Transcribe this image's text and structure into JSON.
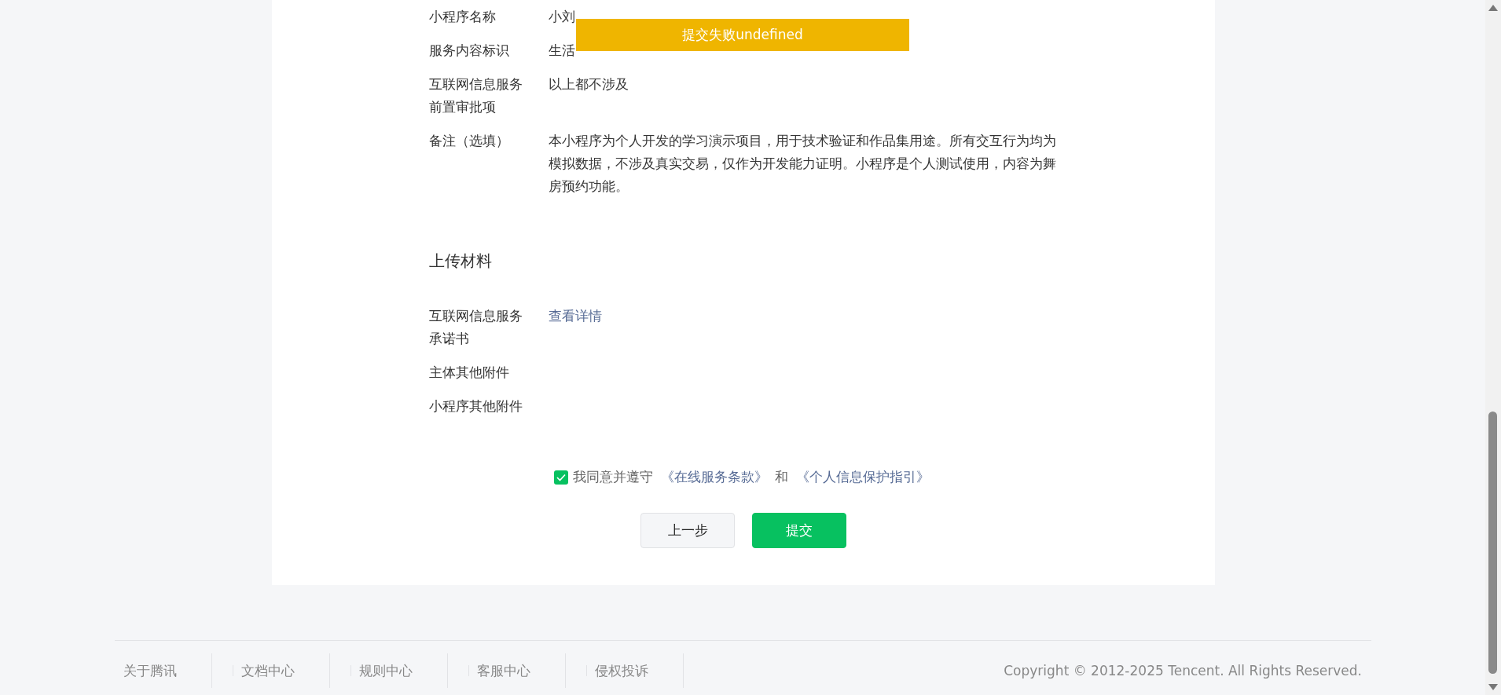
{
  "info_rows": [
    {
      "label": "小程序名称",
      "value": "小刘"
    },
    {
      "label": "服务内容标识",
      "value": "生活"
    },
    {
      "label": "互联网信息服务前置审批项",
      "value": "以上都不涉及"
    },
    {
      "label": "备注（选填）",
      "value": "本小程序为个人开发的学习演示项目，用于技术验证和作品集用途。所有交互行为均为模拟数据，不涉及真实交易，仅作为开发能力证明。小程序是个人测试使用，内容为舞房预约功能。"
    }
  ],
  "toast": {
    "text": "提交失败undefined"
  },
  "upload_section": {
    "title": "上传材料",
    "rows": [
      {
        "label": "互联网信息服务承诺书",
        "link": "查看详情"
      },
      {
        "label": "主体其他附件"
      },
      {
        "label": "小程序其他附件"
      }
    ]
  },
  "agreement": {
    "checked": true,
    "parts": [
      {
        "kind": "text",
        "text": "我同意并遵守"
      },
      {
        "kind": "link",
        "text": "《在线服务条款》"
      },
      {
        "kind": "text",
        "text": "和"
      },
      {
        "kind": "link",
        "text": "《个人信息保护指引》"
      }
    ]
  },
  "buttons": [
    {
      "label": "上一步",
      "kind": "secondary"
    },
    {
      "label": "提交",
      "kind": "primary"
    }
  ],
  "footer": {
    "links": [
      "关于腾讯",
      "文档中心",
      "规则中心",
      "客服中心",
      "侵权投诉"
    ],
    "copyright": "Copyright © 2012-2025 Tencent. All Rights Reserved."
  }
}
